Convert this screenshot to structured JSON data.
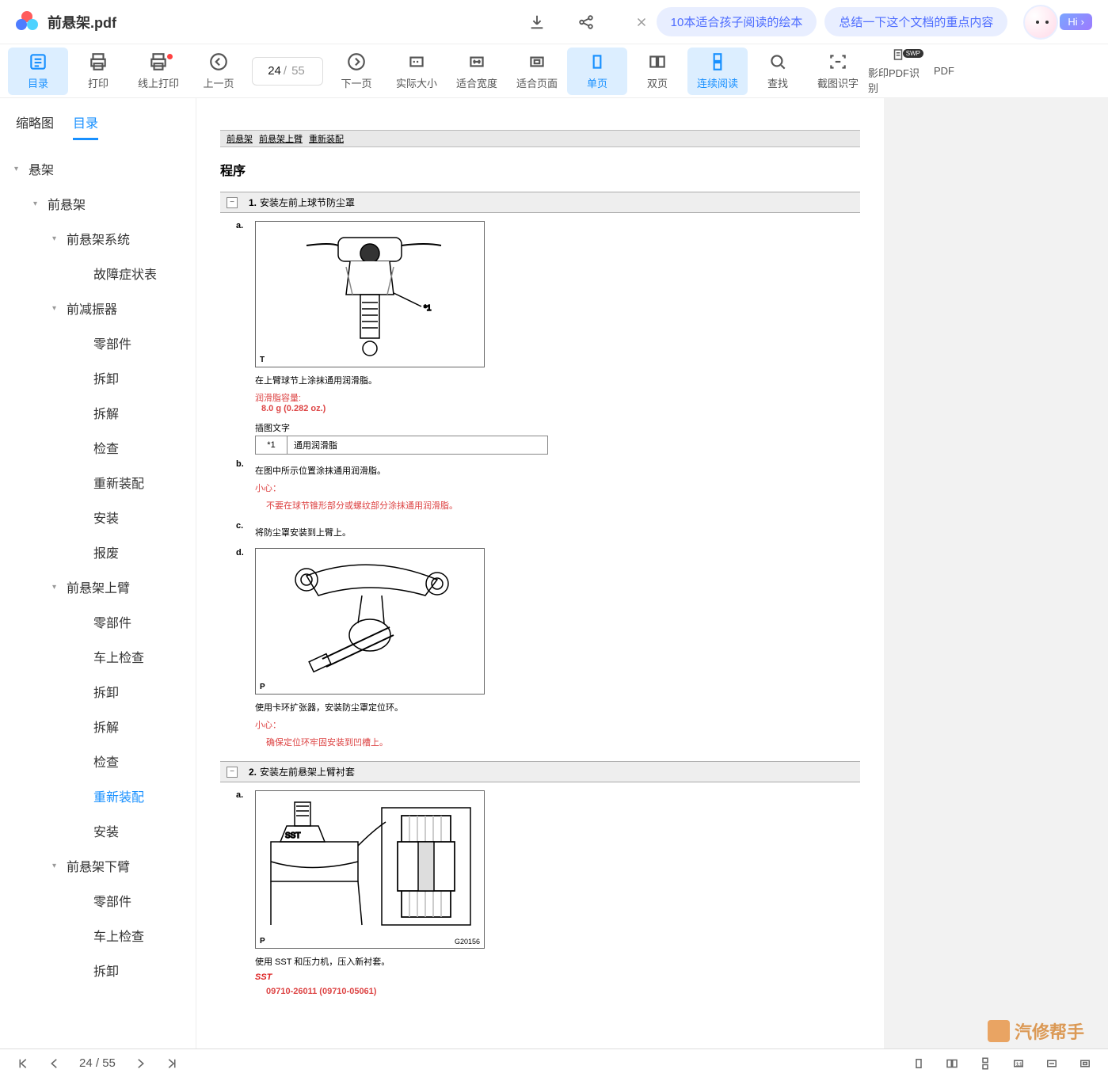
{
  "titlebar": {
    "filename": "前悬架.pdf",
    "suggestion1": "10本适合孩子阅读的绘本",
    "suggestion2": "总结一下这个文档的重点内容",
    "hi_label": "Hi"
  },
  "toolbar": {
    "toc": "目录",
    "print": "打印",
    "online_print": "线上打印",
    "prev_page": "上一页",
    "page_current": "24",
    "page_sep": "/",
    "page_total": "55",
    "next_page": "下一页",
    "actual_size": "实际大小",
    "fit_width": "适合宽度",
    "fit_page": "适合页面",
    "single_page": "单页",
    "double_page": "双页",
    "continuous": "连续阅读",
    "find": "查找",
    "ocr_capture": "截图识字",
    "pdf_ocr": "影印PDF识别",
    "pdf_last": "PDF",
    "swp_badge": "SWP"
  },
  "sidebar": {
    "tab_thumb": "缩略图",
    "tab_toc": "目录",
    "items": [
      {
        "lvl": 1,
        "label": "悬架",
        "arrow": true
      },
      {
        "lvl": 2,
        "label": "前悬架",
        "arrow": true
      },
      {
        "lvl": 3,
        "label": "前悬架系统",
        "arrow": true
      },
      {
        "lvl": 4,
        "label": "故障症状表"
      },
      {
        "lvl": 3,
        "label": "前减振器",
        "arrow": true
      },
      {
        "lvl": 4,
        "label": "零部件"
      },
      {
        "lvl": 4,
        "label": "拆卸"
      },
      {
        "lvl": 4,
        "label": "拆解"
      },
      {
        "lvl": 4,
        "label": "检查"
      },
      {
        "lvl": 4,
        "label": "重新装配"
      },
      {
        "lvl": 4,
        "label": "安装"
      },
      {
        "lvl": 4,
        "label": "报废"
      },
      {
        "lvl": 3,
        "label": "前悬架上臂",
        "arrow": true
      },
      {
        "lvl": 4,
        "label": "零部件"
      },
      {
        "lvl": 4,
        "label": "车上检查"
      },
      {
        "lvl": 4,
        "label": "拆卸"
      },
      {
        "lvl": 4,
        "label": "拆解"
      },
      {
        "lvl": 4,
        "label": "检查"
      },
      {
        "lvl": 4,
        "label": "重新装配",
        "active": true
      },
      {
        "lvl": 4,
        "label": "安装"
      },
      {
        "lvl": 3,
        "label": "前悬架下臂",
        "arrow": true
      },
      {
        "lvl": 4,
        "label": "零部件"
      },
      {
        "lvl": 4,
        "label": "车上检查"
      },
      {
        "lvl": 4,
        "label": "拆卸"
      }
    ]
  },
  "doc": {
    "breadcrumb": [
      "前悬架",
      "前悬架上臂",
      "重新装配"
    ],
    "heading": "程序",
    "section1": {
      "num": "1.",
      "title": "安装左前上球节防尘罩"
    },
    "step_a": {
      "label": "a.",
      "diagram_corner": "T",
      "diagram_note": "*1",
      "text1": "在上臂球节上涂抹通用润滑脂。",
      "cap_label": "润滑脂容量:",
      "cap_value": "8.0 g (0.282 oz.)",
      "illus_label": "插图文字",
      "table_k": "*1",
      "table_v": "通用润滑脂"
    },
    "step_b": {
      "label": "b.",
      "text1": "在图中所示位置涂抹通用润滑脂。",
      "caution": "小心：",
      "caution_text": "不要在球节锥形部分或螺纹部分涂抹通用润滑脂。"
    },
    "step_c": {
      "label": "c.",
      "text1": "将防尘罩安装到上臂上。"
    },
    "step_d": {
      "label": "d.",
      "diagram_corner": "P",
      "text1": "使用卡环扩张器，安装防尘罩定位环。",
      "caution": "小心：",
      "caution_text": "确保定位环牢固安装到凹槽上。"
    },
    "section2": {
      "num": "2.",
      "title": "安装左前悬架上臂衬套"
    },
    "step2_a": {
      "label": "a.",
      "diagram_corner": "P",
      "diagram_sst": "SST",
      "gnum": "G20156",
      "text1": "使用 SST 和压力机，压入新衬套。",
      "sst_label": "SST",
      "sst_value": "09710-26011  (09710-05061)"
    }
  },
  "statusbar": {
    "page_current": "24",
    "page_sep": "/",
    "page_total": "55"
  },
  "watermark": "汽修帮手"
}
